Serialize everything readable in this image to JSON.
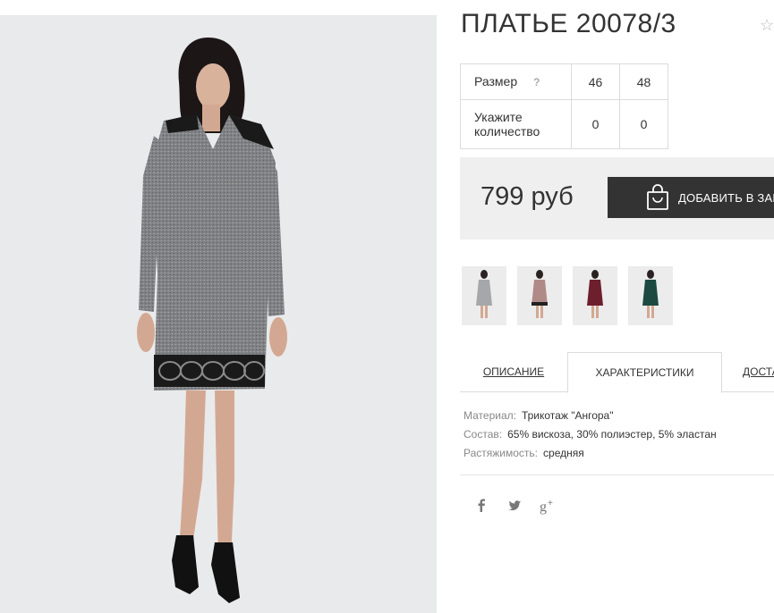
{
  "product": {
    "title": "ПЛАТЬЕ 20078/3",
    "favorite_icon": "star-outline-icon",
    "dress_color": "#7f8082"
  },
  "size_table": {
    "size_label": "Размер",
    "help_mark": "?",
    "sizes": [
      "46",
      "48"
    ],
    "qty_label_line1": "Укажите",
    "qty_label_line2": "количество",
    "quantities": [
      "0",
      "0"
    ]
  },
  "purchase": {
    "price": "799 руб",
    "add_to_cart_label": "ДОБАВИТЬ В ЗАКАЗ",
    "cart_icon": "shopping-bag-icon"
  },
  "thumbnails": [
    {
      "name": "grey",
      "color": "#9c9da0"
    },
    {
      "name": "pink",
      "color": "#b08a86"
    },
    {
      "name": "burgundy",
      "color": "#6e1f2e"
    },
    {
      "name": "green",
      "color": "#1d4a40"
    }
  ],
  "tabs": [
    {
      "label": "ОПИСАНИЕ",
      "active": false
    },
    {
      "label": "ХАРАКТЕРИСТИКИ",
      "active": true
    },
    {
      "label": "ДОСТАВКА",
      "active": false
    }
  ],
  "specs": [
    {
      "key": "Материал:",
      "value": "Трикотаж \"Ангора\""
    },
    {
      "key": "Состав:",
      "value": "65% вискоза, 30% полиэстер, 5% эластан"
    },
    {
      "key": "Растяжимость:",
      "value": "средняя"
    }
  ],
  "social": [
    {
      "icon": "facebook-icon",
      "glyph": "f"
    },
    {
      "icon": "twitter-icon",
      "glyph": "twitter"
    },
    {
      "icon": "google-plus-icon",
      "glyph": "g+"
    }
  ]
}
